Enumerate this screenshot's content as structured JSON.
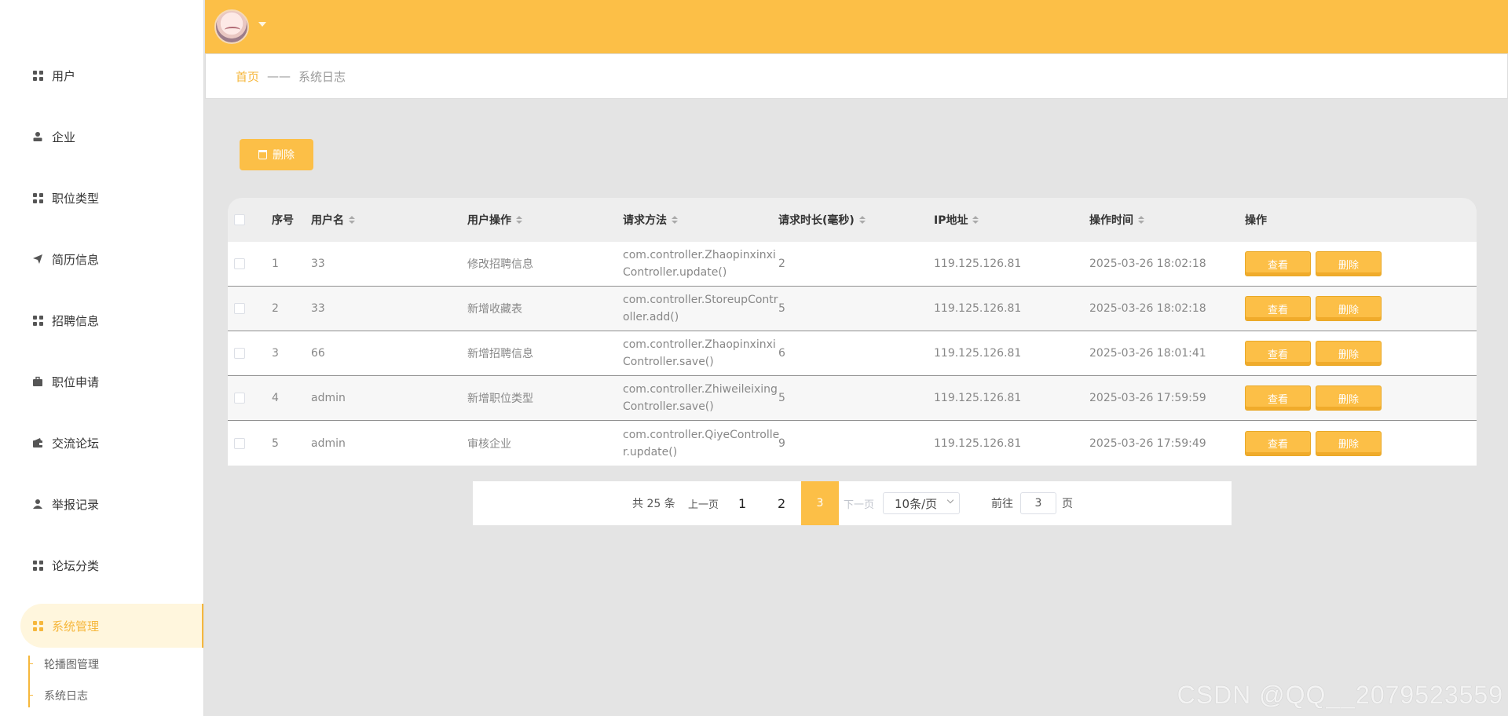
{
  "sidebar": {
    "items": [
      {
        "label": "用户",
        "icon": "grid-icon"
      },
      {
        "label": "企业",
        "icon": "person-icon"
      },
      {
        "label": "职位类型",
        "icon": "grid-icon"
      },
      {
        "label": "简历信息",
        "icon": "send-icon"
      },
      {
        "label": "招聘信息",
        "icon": "grid-icon"
      },
      {
        "label": "职位申请",
        "icon": "briefcase-icon"
      },
      {
        "label": "交流论坛",
        "icon": "wallet-icon"
      },
      {
        "label": "举报记录",
        "icon": "person-icon"
      },
      {
        "label": "论坛分类",
        "icon": "grid-icon"
      },
      {
        "label": "系统管理",
        "icon": "grid-icon"
      }
    ],
    "submenu": [
      {
        "label": "轮播图管理"
      },
      {
        "label": "系统日志"
      }
    ]
  },
  "breadcrumb": {
    "home": "首页",
    "separator": "——",
    "current": "系统日志"
  },
  "toolbar": {
    "delete_label": "删除"
  },
  "table": {
    "columns": [
      "序号",
      "用户名",
      "用户操作",
      "请求方法",
      "请求时长(毫秒)",
      "IP地址",
      "操作时间",
      "操作"
    ],
    "rows": [
      {
        "index": "1",
        "user": "33",
        "op": "修改招聘信息",
        "method1": "com.controller.Zhaopinxinxi",
        "method2": "Controller.update()",
        "duration": "2",
        "ip": "119.125.126.81",
        "time": "2025-03-26 18:02:18"
      },
      {
        "index": "2",
        "user": "33",
        "op": "新增收藏表",
        "method1": "com.controller.StoreupContr",
        "method2": "oller.add()",
        "duration": "5",
        "ip": "119.125.126.81",
        "time": "2025-03-26 18:02:18"
      },
      {
        "index": "3",
        "user": "66",
        "op": "新增招聘信息",
        "method1": "com.controller.Zhaopinxinxi",
        "method2": "Controller.save()",
        "duration": "6",
        "ip": "119.125.126.81",
        "time": "2025-03-26 18:01:41"
      },
      {
        "index": "4",
        "user": "admin",
        "op": "新增职位类型",
        "method1": "com.controller.Zhiweileixing",
        "method2": "Controller.save()",
        "duration": "5",
        "ip": "119.125.126.81",
        "time": "2025-03-26 17:59:59"
      },
      {
        "index": "5",
        "user": "admin",
        "op": "审核企业",
        "method1": "com.controller.QiyeControlle",
        "method2": "r.update()",
        "duration": "9",
        "ip": "119.125.126.81",
        "time": "2025-03-26 17:59:49"
      }
    ],
    "view_label": "查看",
    "delete_label": "删除"
  },
  "pager": {
    "total": "共 25 条",
    "prev": "上一页",
    "pages": [
      "1",
      "2",
      "3"
    ],
    "next": "下一页",
    "page_size": "10条/页",
    "goto_prefix": "前往",
    "goto_value": "3",
    "goto_suffix": "页"
  },
  "watermark": "CSDN @QQ__2079523559",
  "colors": {
    "accent": "#fcbf47",
    "active_text": "#f6b73c",
    "active_bg": "#fff6dd"
  }
}
